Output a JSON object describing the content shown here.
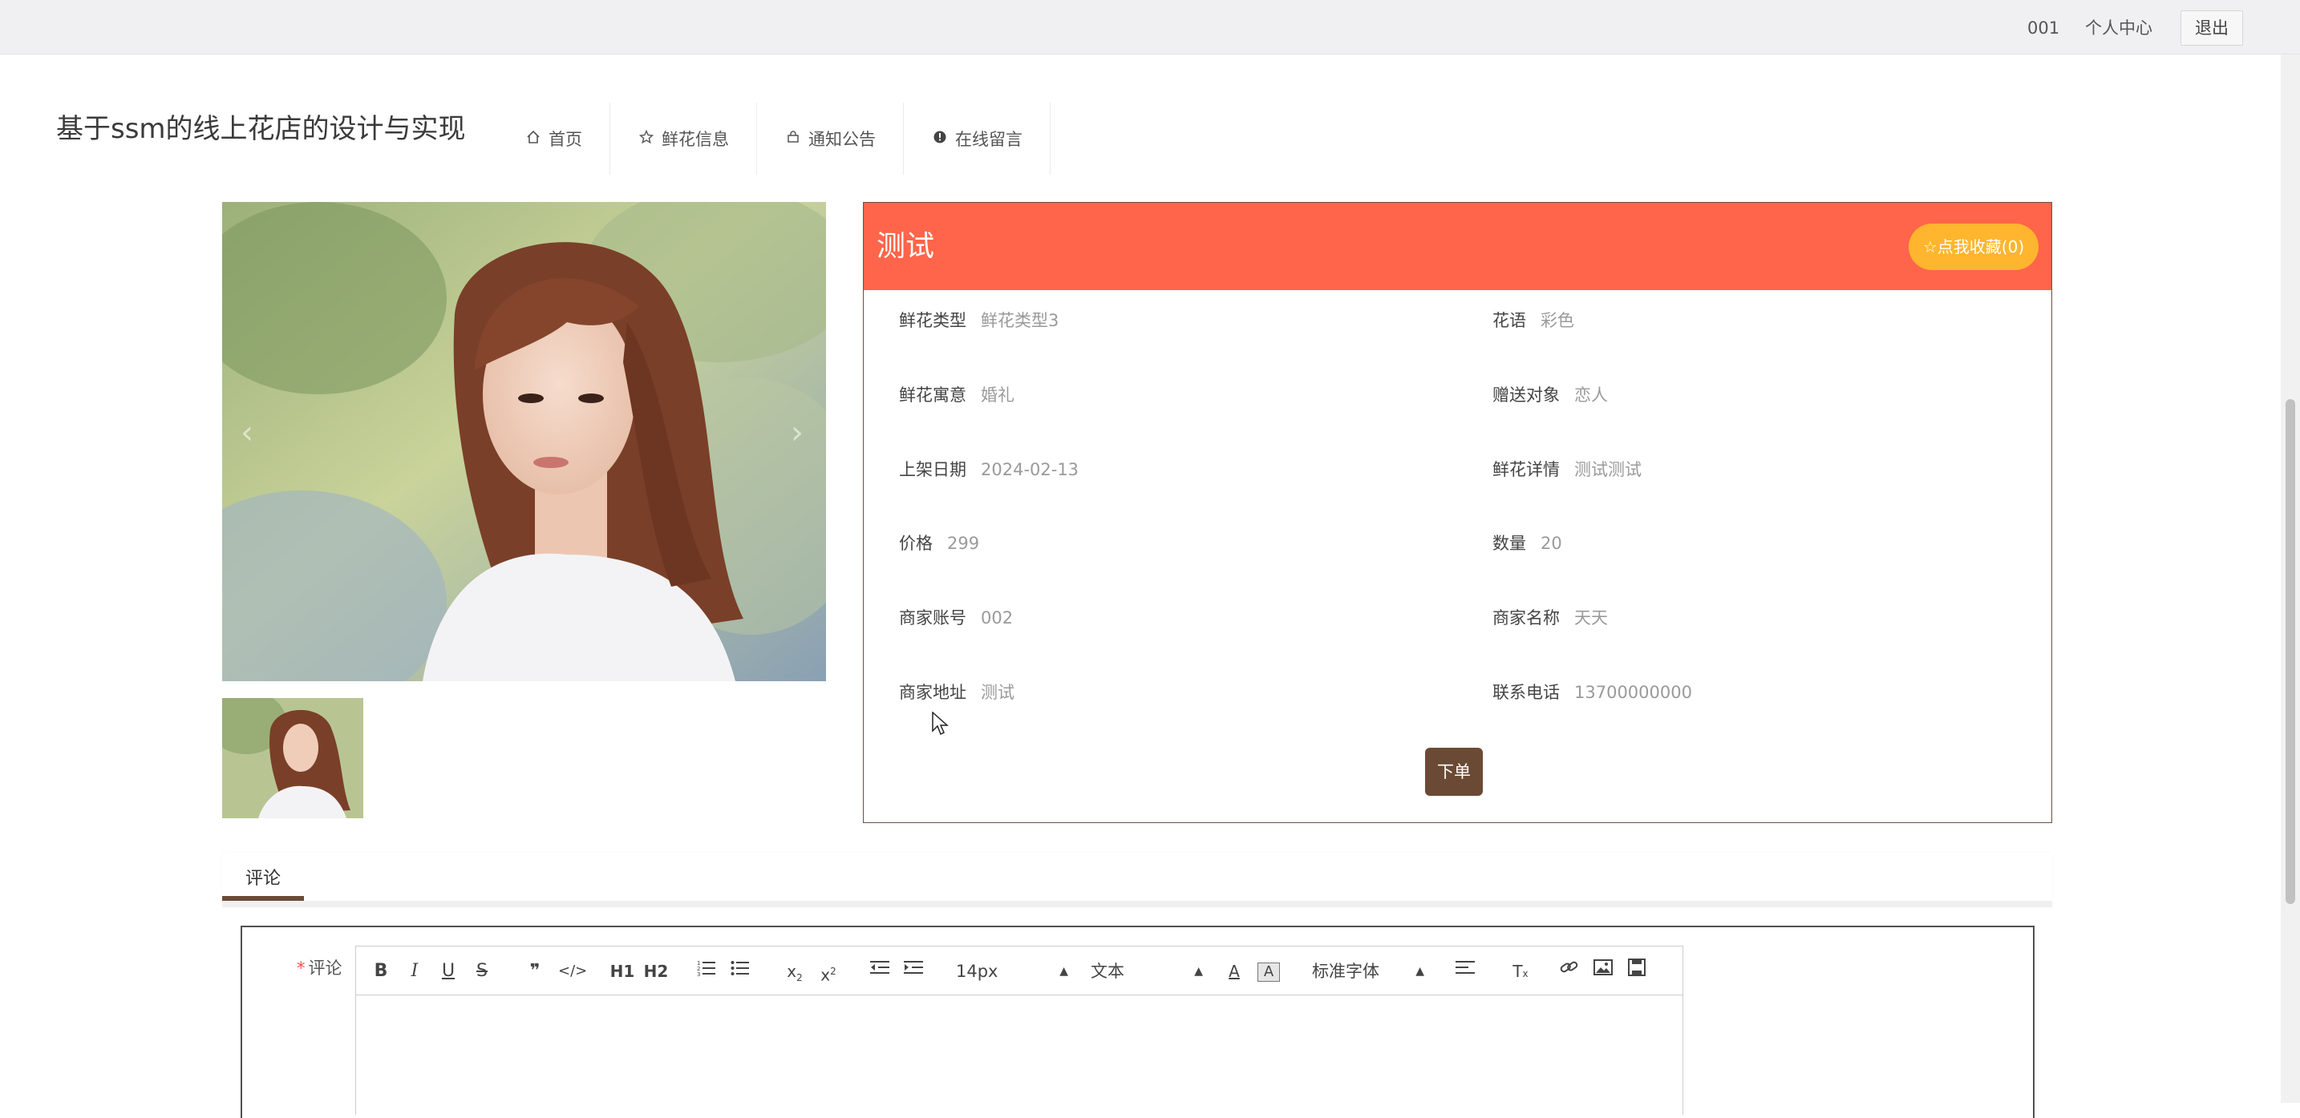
{
  "topbar": {
    "username": "001",
    "user_center": "个人中心",
    "logout": "退出"
  },
  "header": {
    "site_title": "基于ssm的线上花店的设计与实现",
    "nav": [
      {
        "label": "首页",
        "icon": "home-icon"
      },
      {
        "label": "鲜花信息",
        "icon": "star-icon"
      },
      {
        "label": "通知公告",
        "icon": "bag-icon"
      },
      {
        "label": "在线留言",
        "icon": "alert-circle-icon"
      }
    ]
  },
  "product": {
    "name": "测试",
    "favorite_label": "☆点我收藏(0)",
    "fields": [
      {
        "label": "鲜花类型",
        "value": "鲜花类型3"
      },
      {
        "label": "花语",
        "value": "彩色"
      },
      {
        "label": "鲜花寓意",
        "value": "婚礼"
      },
      {
        "label": "赠送对象",
        "value": "恋人"
      },
      {
        "label": "上架日期",
        "value": "2024-02-13"
      },
      {
        "label": "鲜花详情",
        "value": "测试测试"
      },
      {
        "label": "价格",
        "value": "299"
      },
      {
        "label": "数量",
        "value": "20"
      },
      {
        "label": "商家账号",
        "value": "002"
      },
      {
        "label": "商家名称",
        "value": "天天"
      },
      {
        "label": "商家地址",
        "value": "测试"
      },
      {
        "label": "联系电话",
        "value": "13700000000"
      }
    ],
    "order_button": "下单"
  },
  "tabs": {
    "comment": "评论"
  },
  "comment_form": {
    "required_mark": "*",
    "label": "评论",
    "toolbar": {
      "font_size": "14px",
      "header_select": "文本",
      "font_family": "标准字体",
      "header1": "H1",
      "header2": "H2"
    }
  }
}
